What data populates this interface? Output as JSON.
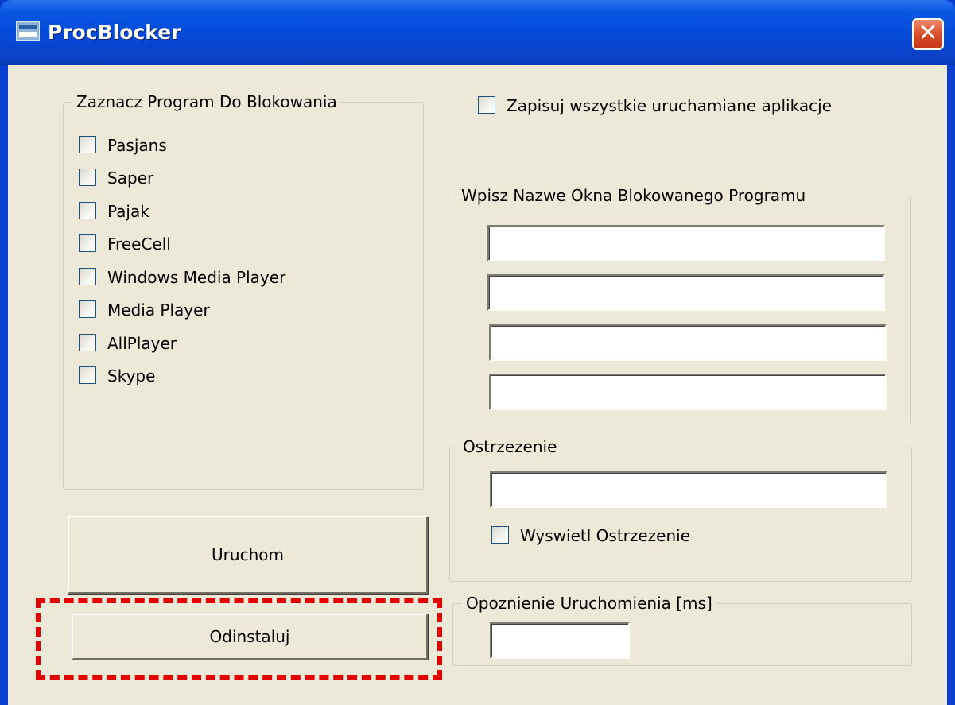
{
  "window": {
    "title": "ProcBlocker",
    "close_glyph": "✕",
    "icon": "app-icon",
    "accent": "#0a58e3"
  },
  "block_programs": {
    "legend": "Zaznacz Program Do Blokowania",
    "items": [
      {
        "label": "Pasjans",
        "checked": false
      },
      {
        "label": "Saper",
        "checked": false
      },
      {
        "label": "Pajak",
        "checked": false
      },
      {
        "label": "FreeCell",
        "checked": false
      },
      {
        "label": "Windows Media Player",
        "checked": false
      },
      {
        "label": "Media Player",
        "checked": false
      },
      {
        "label": "AllPlayer",
        "checked": false
      },
      {
        "label": "Skype",
        "checked": false
      }
    ]
  },
  "log_all": {
    "label": "Zapisuj wszystkie uruchamiane aplikacje",
    "checked": false
  },
  "window_names": {
    "legend": "Wpisz Nazwe Okna Blokowanego Programu",
    "fields": [
      "",
      "",
      "",
      ""
    ]
  },
  "warning": {
    "legend": "Ostrzezenie",
    "text_value": "",
    "show_label": "Wyswietl Ostrzezenie",
    "show_checked": false
  },
  "delay": {
    "legend": "Opoznienie Uruchomienia [ms]",
    "value": ""
  },
  "buttons": {
    "run_label": "Uruchom",
    "uninstall_label": "Odinstaluj"
  },
  "annotation": {
    "color": "#e30000",
    "style": "dashed"
  }
}
